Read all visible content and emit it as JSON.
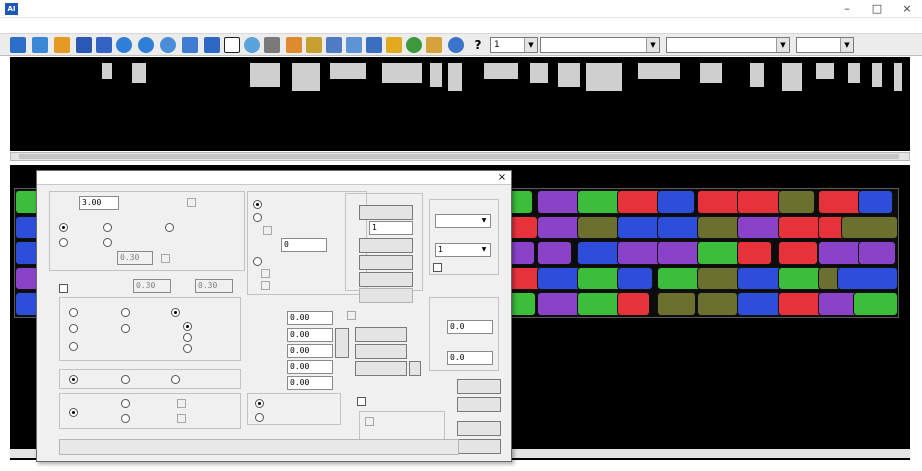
{
  "window": {
    "title": "",
    "app_icon_text": "AI",
    "controls": {
      "minimize": "–",
      "maximize": "□",
      "close": "×"
    }
  },
  "menu": {
    "items": [
      "",
      "",
      "",
      "",
      "",
      "",
      "",
      "",
      "",
      ""
    ]
  },
  "toolbar": {
    "help_icon_text": "?",
    "combo_1": "1",
    "combo_2": "",
    "combo_3": "",
    "combo_4": ""
  },
  "piece_panel": {
    "header_label": "",
    "row_labels": [
      "",
      "",
      "",
      "",
      "",
      ""
    ]
  },
  "colors": {
    "app_icon": "#1d58b8",
    "label_green": "#3ee06a",
    "piece_red": "#e8323b",
    "piece_green": "#3cbd3c",
    "piece_purple": "#8a43c8",
    "piece_olive": "#6b7031",
    "piece_blue": "#2c4ed8"
  },
  "dialog": {
    "title": "",
    "close": "×",
    "spacing_label": "",
    "spacing_value": "3.00",
    "spacing_check": "",
    "radio_row1": [
      "",
      "",
      ""
    ],
    "radio_row2": [
      "",
      ""
    ],
    "tolerance_label": "",
    "tolerance_value": "0.30",
    "tolerance_check": "",
    "piece_check": "",
    "piece_start_label": "",
    "piece_start_value": "0.30",
    "piece_end_label": "",
    "piece_end_value": "0.30",
    "direction_options": [
      "",
      "",
      "",
      "",
      "",
      ""
    ],
    "rotate_label": "",
    "rotate_values": [
      "",
      "",
      "",
      ""
    ],
    "mode_options": [
      "",
      "",
      ""
    ],
    "split_options": [
      "",
      "",
      "",
      "",
      ""
    ],
    "auto_radio": "",
    "auto_radio_2": "",
    "auto_check": "",
    "sync_label": "",
    "sync_value": "0",
    "match_radio": "",
    "match_sub": [
      "",
      ""
    ],
    "param_fields": [
      {
        "label": "",
        "value": "0.00"
      },
      {
        "label": "",
        "value": "0.00"
      },
      {
        "label": "",
        "value": "0.00"
      },
      {
        "label": "",
        "value": "0.00"
      },
      {
        "label": "",
        "value": "0.00"
      }
    ],
    "fold_button": "",
    "lock_check": "",
    "placement_radios": [
      "",
      ""
    ],
    "middle_title": "",
    "middle_buttons": [
      "",
      "",
      "",
      ""
    ],
    "middle_field_label": "",
    "middle_field_value": "1",
    "middle_disabled_button": "",
    "rotate_check": "",
    "action_buttons": [
      "",
      "",
      ""
    ],
    "action_button_4": "",
    "right_label_1": "",
    "right_select_1": "",
    "right_label_2": "",
    "right_select_2": "1",
    "right_check": "",
    "right_group_title": "",
    "right_field_1_label": "",
    "right_field_1_value": "0.0",
    "right_field_2_label": "",
    "right_field_2_value": "0.0",
    "left_right_check": "",
    "sub_check_1": "",
    "sub_check_2": "",
    "bottom_buttons": [
      "",
      "",
      "",
      ""
    ]
  }
}
